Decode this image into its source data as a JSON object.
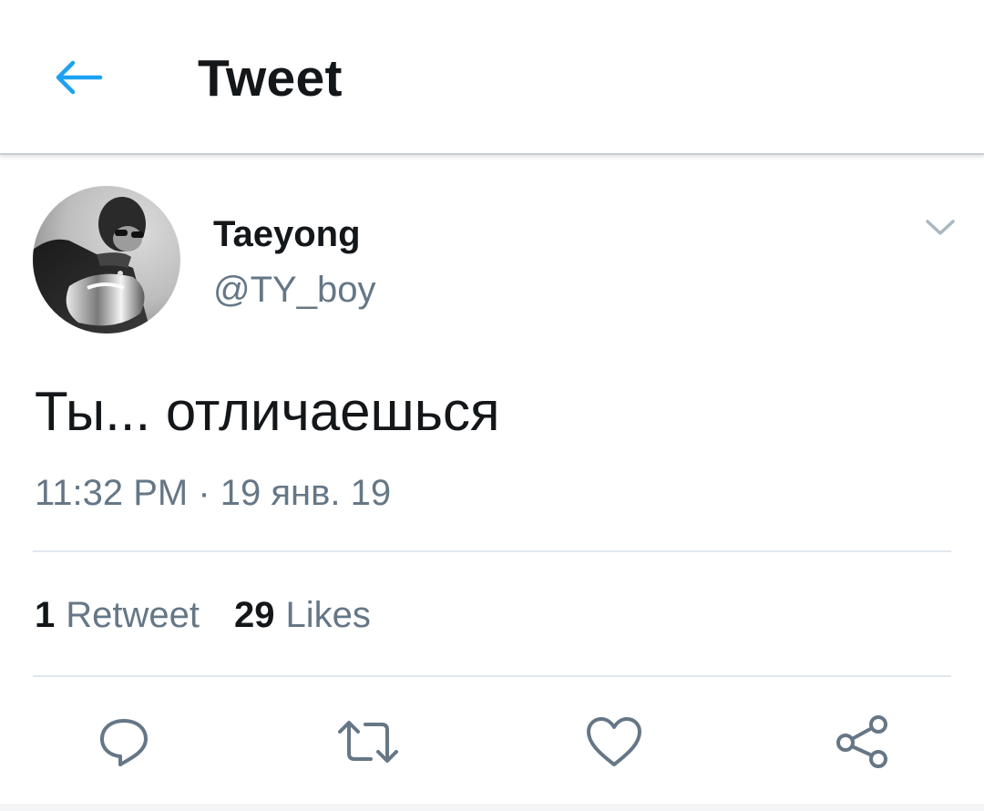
{
  "app_bar": {
    "title": "Tweet",
    "back_icon": "arrow-left-icon",
    "accent_color": "#1da1f2"
  },
  "tweet": {
    "author": {
      "display_name": "Taeyong",
      "handle": "@TY_boy",
      "avatar": "profile-photo"
    },
    "text": "Ты... отличаешься",
    "timestamp": "11:32 PM · 19 янв. 19",
    "stats": {
      "retweets_count": "1",
      "retweets_label": "Retweet",
      "likes_count": "29",
      "likes_label": "Likes"
    },
    "actions": [
      {
        "icon": "reply-icon"
      },
      {
        "icon": "retweet-icon"
      },
      {
        "icon": "heart-icon"
      },
      {
        "icon": "share-icon"
      }
    ]
  },
  "colors": {
    "text_primary": "#14171a",
    "text_secondary": "#657786",
    "divider": "#e1e8ed"
  }
}
